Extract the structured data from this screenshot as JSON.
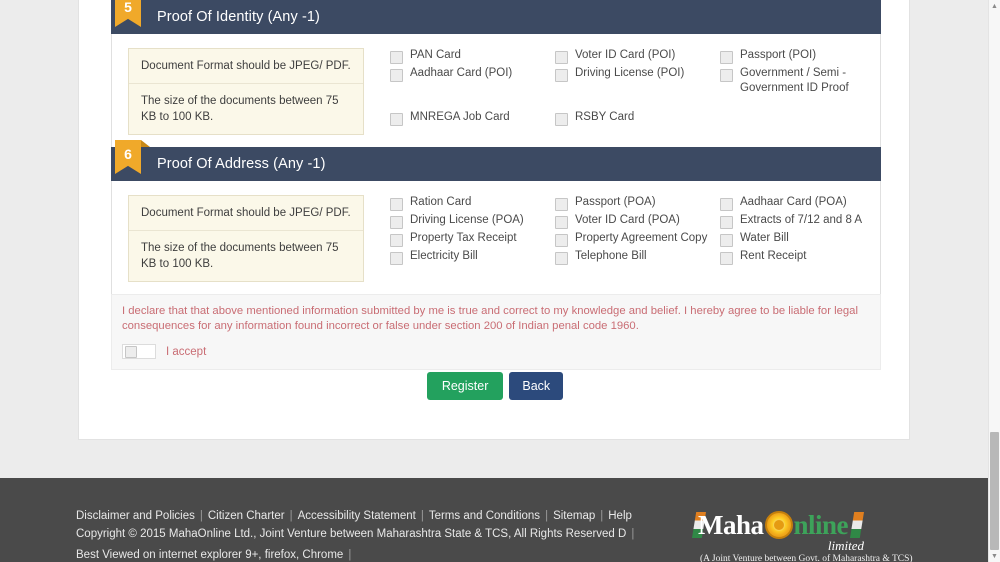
{
  "sections": [
    {
      "number": "5",
      "title": "Proof Of Identity (Any -1)",
      "notes": [
        "Document Format should be JPEG/ PDF.",
        "The size of the documents between 75 KB to 100 KB."
      ],
      "options": [
        "PAN Card",
        "Voter ID Card (POI)",
        "Passport (POI)",
        "Aadhaar Card (POI)",
        "Driving License (POI)",
        "Government / Semi - Government ID Proof",
        "MNREGA Job Card",
        "RSBY Card",
        ""
      ]
    },
    {
      "number": "6",
      "title": "Proof Of Address (Any -1)",
      "notes": [
        "Document Format should be JPEG/ PDF.",
        "The size of the documents between 75 KB to 100 KB."
      ],
      "options": [
        "Ration Card",
        "Passport (POA)",
        "Aadhaar Card (POA)",
        "Driving License (POA)",
        "Voter ID Card (POA)",
        "Extracts of 7/12 and 8 A",
        "Property Tax Receipt",
        "Property Agreement Copy",
        "Water Bill",
        "Electricity Bill",
        "Telephone Bill",
        "Rent Receipt"
      ]
    }
  ],
  "declaration": {
    "text": "I declare that that above mentioned information submitted by me is true and correct to my knowledge and belief. I hereby agree to be liable for legal consequences for any information found incorrect or false under section 200 of Indian penal code 1960.",
    "accept_label": "I accept",
    "text_color": "#c96d74"
  },
  "buttons": {
    "register": "Register",
    "back": "Back",
    "register_color": "#23a15e",
    "back_color": "#2c4a7c"
  },
  "footer": {
    "links": [
      "Disclaimer and Policies",
      "Citizen Charter",
      "Accessibility Statement",
      "Terms and Conditions",
      "Sitemap",
      "Help"
    ],
    "copyright": "Copyright © 2015 MahaOnline Ltd., Joint Venture between Maharashtra State & TCS, All Rights Reserved D",
    "best_viewed": "Best Viewed on internet explorer 9+, firefox, Chrome",
    "logo": {
      "part1": "Maha",
      "sun_icon": "sun-icon",
      "part2": "nline",
      "limited": "limited",
      "tagline": "(A Joint Venture between Govt. of Maharashtra & TCS)"
    }
  },
  "scrollbar": {
    "up_arrow": "▲",
    "down_arrow": "▼"
  }
}
